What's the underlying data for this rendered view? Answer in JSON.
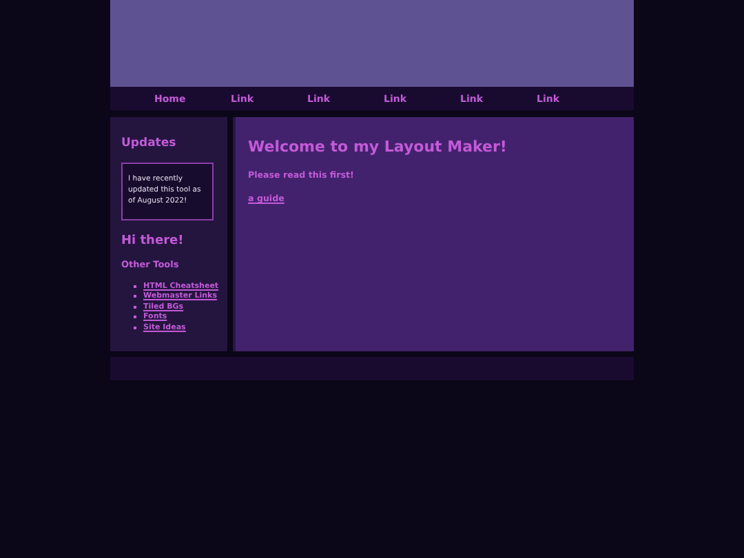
{
  "nav": [
    {
      "label": "Home"
    },
    {
      "label": "Link"
    },
    {
      "label": "Link"
    },
    {
      "label": "Link"
    },
    {
      "label": "Link"
    },
    {
      "label": "Link"
    }
  ],
  "sidebar": {
    "updates_title": "Updates",
    "updates_text": "I have recently updated this tool as of August 2022!",
    "greeting": "Hi there!",
    "tools_title": "Other Tools",
    "links": [
      "HTML Cheatsheet",
      "Webmaster Links",
      "Tiled BGs",
      "Fonts",
      "Site Ideas"
    ]
  },
  "main": {
    "title": "Welcome to my Layout Maker!",
    "subtitle": "Please read this first!",
    "link": "a guide"
  }
}
